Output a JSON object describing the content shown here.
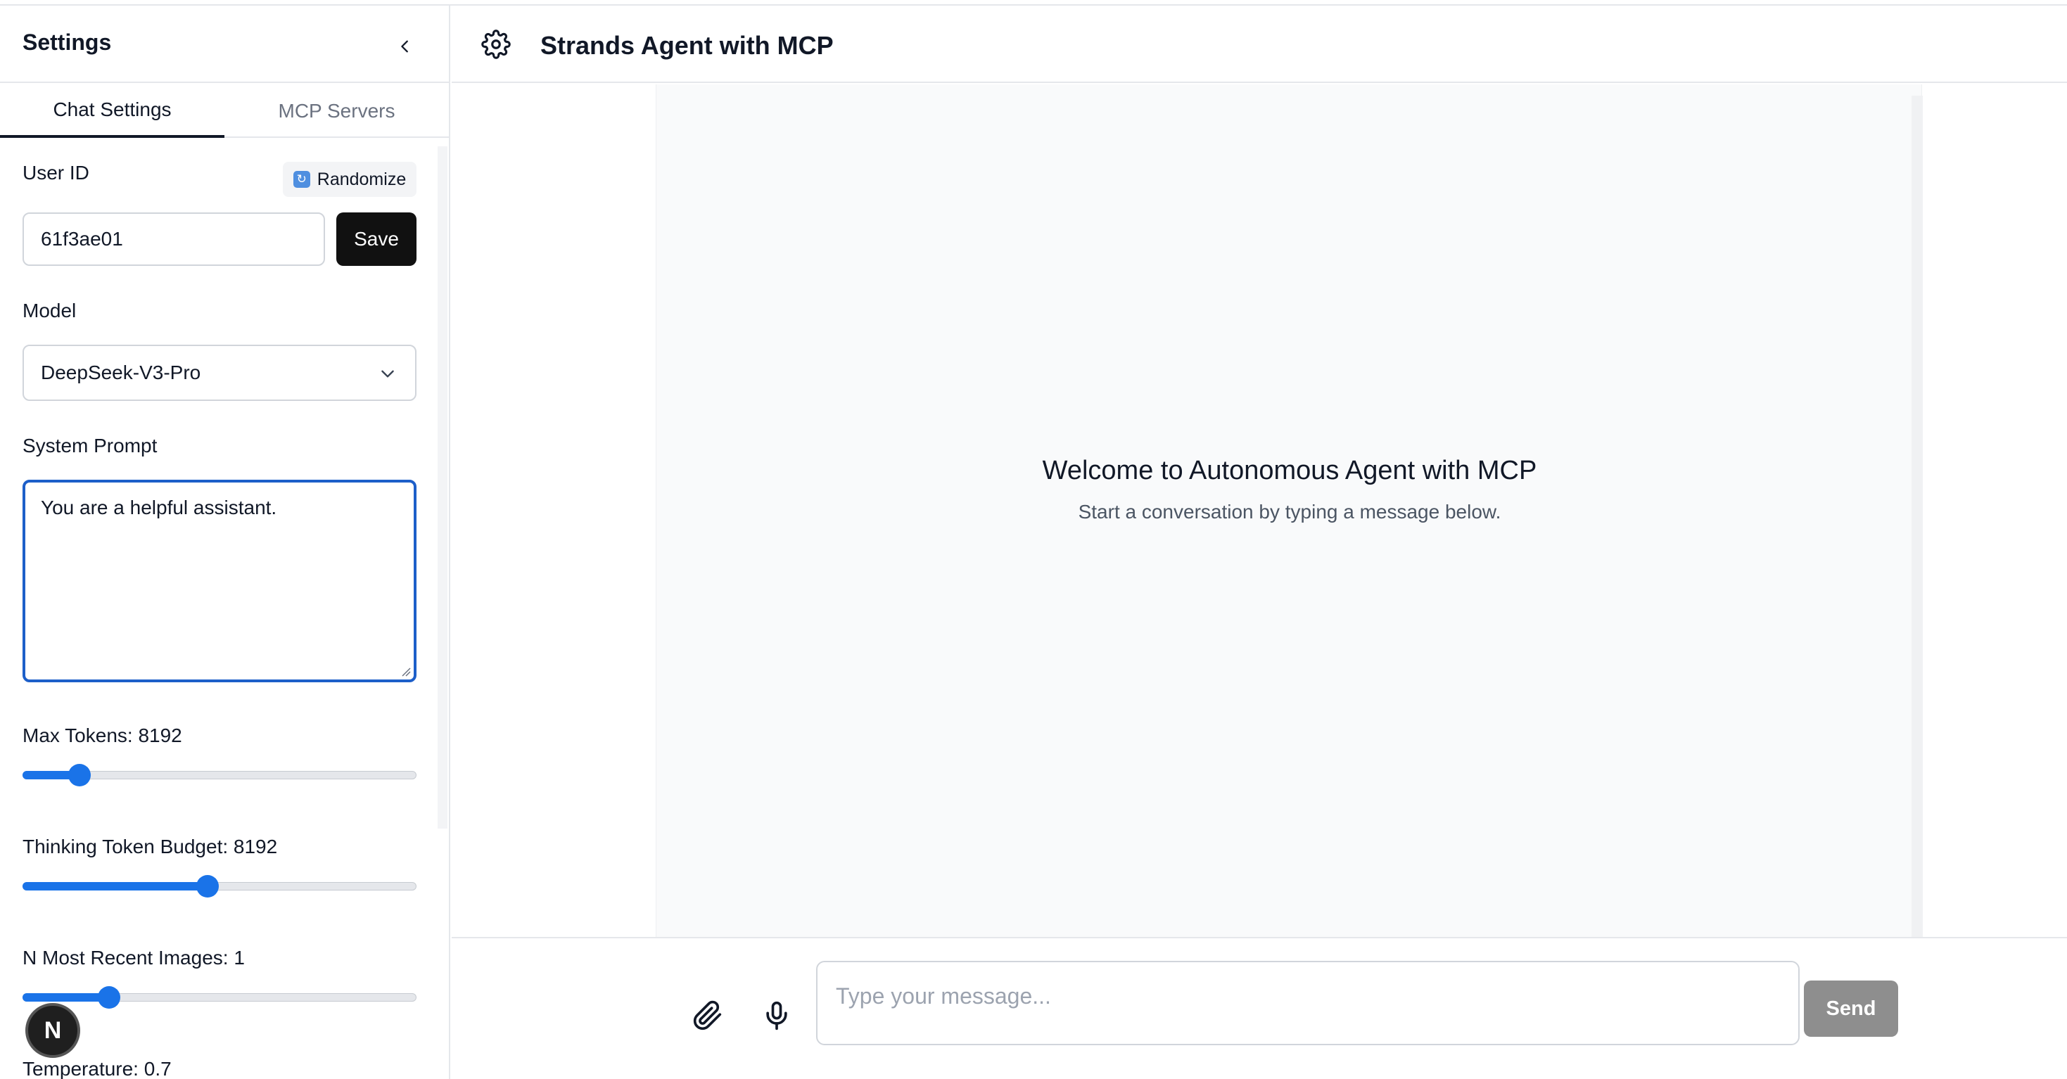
{
  "sidebar": {
    "title": "Settings",
    "tabs": [
      {
        "label": "Chat Settings",
        "active": true
      },
      {
        "label": "MCP Servers",
        "active": false
      }
    ],
    "user_id": {
      "label": "User ID",
      "randomize_label": "Randomize",
      "value": "61f3ae01",
      "save_label": "Save"
    },
    "model": {
      "label": "Model",
      "selected": "DeepSeek-V3-Pro"
    },
    "system_prompt": {
      "label": "System Prompt",
      "value": "You are a helpful assistant."
    },
    "sliders": {
      "max_tokens": {
        "label": "Max Tokens: 8192",
        "value": 8192,
        "fraction": 0.145
      },
      "thinking_budget": {
        "label": "Thinking Token Budget: 8192",
        "value": 8192,
        "fraction": 0.47
      },
      "recent_images": {
        "label": "N Most Recent Images: 1",
        "value": 1,
        "fraction": 0.22
      }
    },
    "temperature_label": "Temperature: 0.7",
    "badge_letter": "N"
  },
  "header": {
    "title": "Strands Agent with MCP",
    "icon": "gear-icon"
  },
  "chat": {
    "welcome_title": "Welcome to Autonomous Agent with MCP",
    "welcome_subtitle": "Start a conversation by typing a message below."
  },
  "composer": {
    "placeholder": "Type your message...",
    "send_label": "Send"
  },
  "colors": {
    "accent": "#1a73e8",
    "focus_border": "#1d5fc9",
    "send_disabled": "#8e8e8e"
  }
}
